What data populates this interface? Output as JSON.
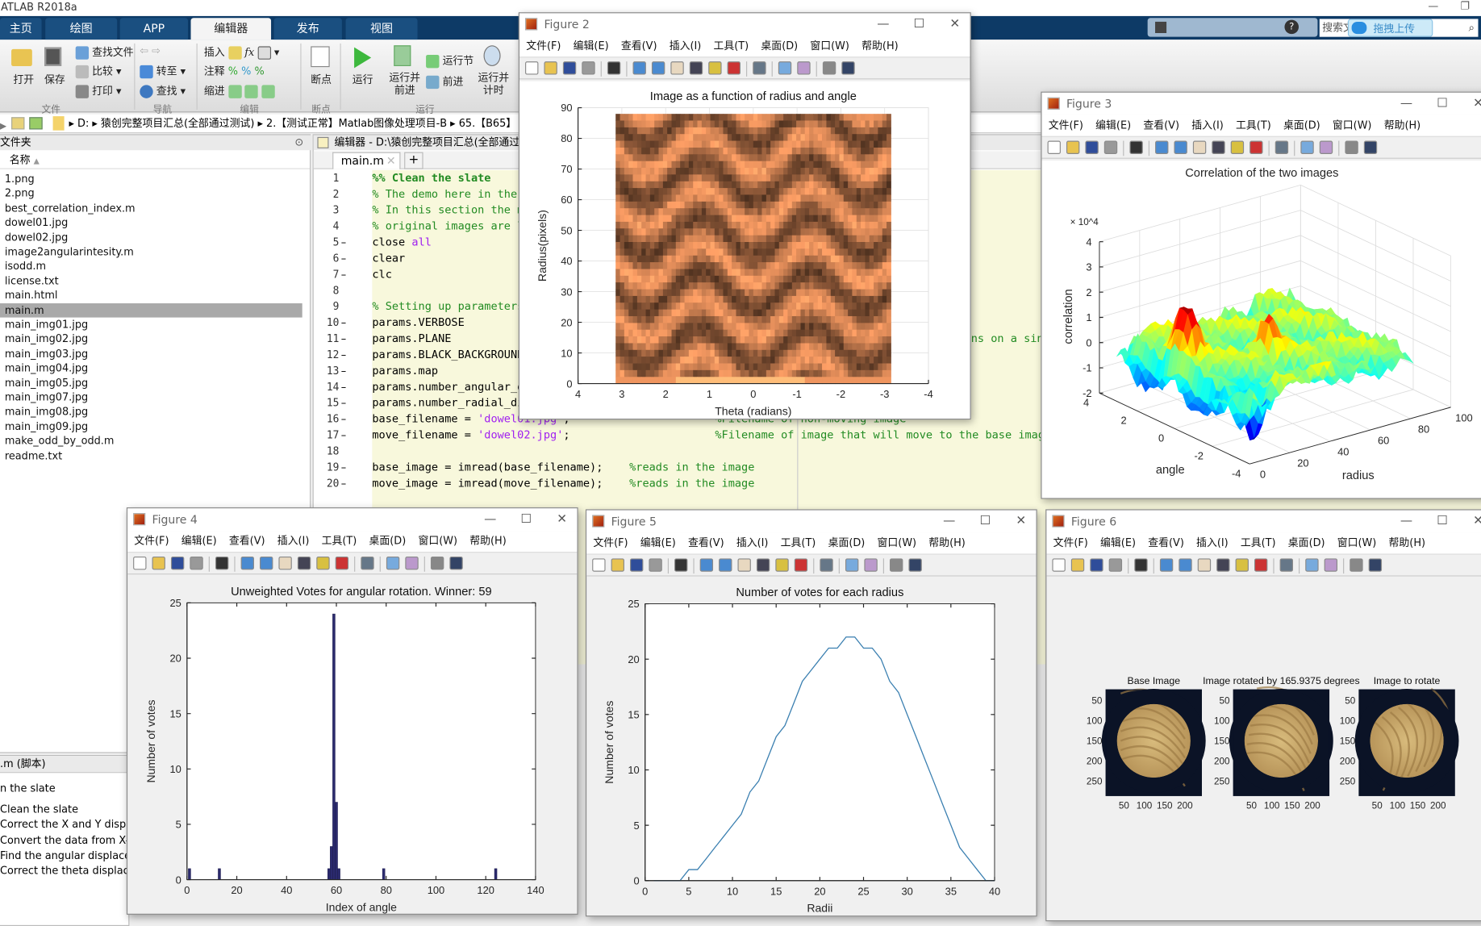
{
  "app": {
    "title": "ATLAB R2018a"
  },
  "ribbon": {
    "tabs": [
      "主页",
      "绘图",
      "APP",
      "编辑器",
      "发布",
      "视图"
    ],
    "active_tab": "编辑器",
    "file_group": {
      "label": "文件",
      "open": "打开",
      "save": "保存",
      "find_files": "查找文件",
      "compare": "比较",
      "print": "打印"
    },
    "nav_group": {
      "label": "导航",
      "goto": "转至",
      "find": "查找"
    },
    "edit_group": {
      "label": "编辑",
      "insert": "插入",
      "comment": "注释",
      "indent": "缩进"
    },
    "breakpoint_group": {
      "label": "断点",
      "breakpoints": "断点"
    },
    "run_group": {
      "label": "运行",
      "run": "运行",
      "run_advance": "运行并\n前进",
      "run_section": "运行节",
      "advance": "前进",
      "run_time": "运行并\n计时"
    },
    "search_placeholder": "搜索文",
    "upload_overlay": "拖拽上传"
  },
  "address": {
    "segments": [
      "D:",
      "猿创完整项目汇总(全部通过测试)",
      "2.【测试正常】Matlab图像处理项目-B",
      "65.【B65】"
    ]
  },
  "files": {
    "header": "文件夹",
    "column": "名称",
    "selected": "main.m",
    "items": [
      "1.png",
      "2.png",
      "best_correlation_index.m",
      "dowel01.jpg",
      "dowel02.jpg",
      "image2angularintesity.m",
      "isodd.m",
      "license.txt",
      "main.html",
      "main.m",
      "main_img01.jpg",
      "main_img02.jpg",
      "main_img03.jpg",
      "main_img04.jpg",
      "main_img05.jpg",
      "main_img07.jpg",
      "main_img08.jpg",
      "main_img09.jpg",
      "make_odd_by_odd.m",
      "readme.txt"
    ]
  },
  "details": {
    "header": ".m  (脚本)",
    "title": "n the slate",
    "items": [
      "Clean the slate",
      "Correct the X and Y displac",
      "Convert the data from X-Y c",
      "Find the angular displaceme",
      "Correct the theta displacem"
    ]
  },
  "editor": {
    "title": "编辑器 - D:\\猿创完整项目汇总(全部通过测试",
    "tab": "main.m",
    "fragment": "ns on a singl",
    "lines": [
      {
        "n": "1",
        "dash": "",
        "parts": [
          [
            "%% Clean the slate",
            "sec"
          ]
        ]
      },
      {
        "n": "2",
        "dash": "",
        "parts": [
          [
            "% The demo here in the mai",
            "cm"
          ]
        ]
      },
      {
        "n": "3",
        "dash": "",
        "parts": [
          [
            "% In this section the memo",
            "cm"
          ]
        ]
      },
      {
        "n": "4",
        "dash": "",
        "parts": [
          [
            "% original images are load",
            "cm"
          ]
        ]
      },
      {
        "n": "5",
        "dash": "–",
        "parts": [
          [
            "close ",
            "tx"
          ],
          [
            "all",
            "str"
          ]
        ]
      },
      {
        "n": "6",
        "dash": "–",
        "parts": [
          [
            "clear",
            "tx"
          ]
        ]
      },
      {
        "n": "7",
        "dash": "–",
        "parts": [
          [
            "clc",
            "tx"
          ]
        ]
      },
      {
        "n": "8",
        "dash": "",
        "parts": []
      },
      {
        "n": "9",
        "dash": "",
        "parts": [
          [
            "% Setting up parameters an",
            "cm"
          ]
        ]
      },
      {
        "n": "10",
        "dash": "–",
        "parts": [
          [
            "params.VERBOSE          =",
            "tx"
          ]
        ]
      },
      {
        "n": "11",
        "dash": "–",
        "parts": [
          [
            "params.PLANE            =",
            "tx"
          ]
        ]
      },
      {
        "n": "12",
        "dash": "–",
        "parts": [
          [
            "params.BLACK_BACKGROUND =",
            "tx"
          ]
        ]
      },
      {
        "n": "13",
        "dash": "–",
        "parts": [
          [
            "params.map",
            "tx"
          ]
        ]
      },
      {
        "n": "14",
        "dash": "–",
        "parts": [
          [
            "params.number_angular_divi",
            "tx"
          ]
        ]
      },
      {
        "n": "15",
        "dash": "–",
        "parts": [
          [
            "params.number_radial_divis",
            "tx"
          ]
        ]
      },
      {
        "n": "16",
        "dash": "–",
        "parts": [
          [
            "base_filename = ",
            "tx"
          ],
          [
            "'dowel01.jpg'",
            "str"
          ],
          [
            ";                      ",
            "tx"
          ],
          [
            "%Filename of non-moving image",
            "cm"
          ]
        ]
      },
      {
        "n": "17",
        "dash": "–",
        "parts": [
          [
            "move_filename = ",
            "tx"
          ],
          [
            "'dowel02.jpg'",
            "str"
          ],
          [
            ";                      ",
            "tx"
          ],
          [
            "%Filename of image that will move to the base image",
            "cm"
          ]
        ]
      },
      {
        "n": "18",
        "dash": "",
        "parts": []
      },
      {
        "n": "19",
        "dash": "–",
        "parts": [
          [
            "base_image = imread(base_filename);    ",
            "tx"
          ],
          [
            "%reads in the image",
            "cm"
          ]
        ]
      },
      {
        "n": "20",
        "dash": "–",
        "parts": [
          [
            "move_image = imread(move_filename);    ",
            "tx"
          ],
          [
            "%reads in the image",
            "cm"
          ]
        ]
      }
    ]
  },
  "figure_menu": [
    "文件(F)",
    "编辑(E)",
    "查看(V)",
    "插入(I)",
    "工具(T)",
    "桌面(D)",
    "窗口(W)",
    "帮助(H)"
  ],
  "figure_toolbar_icons": [
    "new-icon",
    "open-icon",
    "save-icon",
    "print-icon",
    "|",
    "pointer-icon",
    "|",
    "zoom-in-icon",
    "zoom-out-icon",
    "pan-icon",
    "rotate-icon",
    "data-cursor-icon",
    "brush-icon",
    "|",
    "link-icon",
    "|",
    "colorbar-icon",
    "legend-icon",
    "|",
    "hide-tools-icon",
    "show-tools-icon"
  ],
  "figures": [
    {
      "title": "Figure 2"
    },
    {
      "title": "Figure 3"
    },
    {
      "title": "Figure 4"
    },
    {
      "title": "Figure 5"
    },
    {
      "title": "Figure 6",
      "images": [
        {
          "title": "Base Image",
          "yticks": [
            "50",
            "100",
            "150",
            "200",
            "250"
          ],
          "xticks": [
            "50",
            "100",
            "150",
            "200"
          ]
        },
        {
          "title": "Image rotated by 165.9375 degrees",
          "yticks": [
            "50",
            "100",
            "150",
            "200",
            "250"
          ],
          "xticks": [
            "50",
            "100",
            "150",
            "200"
          ]
        },
        {
          "title": "Image to rotate",
          "yticks": [
            "50",
            "100",
            "150",
            "200",
            "250"
          ],
          "xticks": [
            "50",
            "100",
            "150",
            "200"
          ]
        }
      ]
    }
  ],
  "chart_data": [
    {
      "type": "heatmap",
      "title": "Image as a function of radius and angle",
      "xlabel": "Theta (radians)",
      "ylabel": "Radius(pixels)",
      "xlim": [
        4,
        -4
      ],
      "ylim": [
        0,
        90
      ],
      "xdir": "reverse",
      "colormap": "copper",
      "grid": true,
      "xticks": [
        "4",
        "3",
        "2",
        "1",
        "0",
        "-1",
        "-2",
        "-3",
        "-4"
      ],
      "yticks": [
        "0",
        "10",
        "20",
        "30",
        "40",
        "50",
        "60",
        "70",
        "80",
        "90"
      ]
    },
    {
      "type": "surface",
      "title": "Correlation of the two images",
      "xlabel": "radius",
      "ylabel": "angle",
      "zlabel": "correlation",
      "zexponent": "× 10^4",
      "xlim": [
        0,
        100
      ],
      "ylim": [
        -4,
        4
      ],
      "zlim": [
        -2,
        4
      ],
      "colormap": "jet",
      "grid": true,
      "xticks": [
        "0",
        "20",
        "40",
        "60",
        "80",
        "100"
      ],
      "yticks": [
        "4",
        "2",
        "0",
        "-2",
        "-4"
      ],
      "zticks": [
        "4",
        "3",
        "2",
        "1",
        "0",
        "-1",
        "-2"
      ]
    },
    {
      "type": "bar",
      "title": "Unweighted Votes for angular rotation. Winner: 59",
      "xlabel": "Index of angle",
      "ylabel": "Number of votes",
      "xlim": [
        0,
        140
      ],
      "ylim": [
        0,
        25
      ],
      "color": "#2b2a6e",
      "x": [
        1,
        13,
        57,
        58,
        59,
        60,
        61,
        79,
        124
      ],
      "values": [
        1,
        1,
        1,
        3,
        24,
        7,
        1,
        1,
        1
      ],
      "xticks": [
        "0",
        "20",
        "40",
        "60",
        "80",
        "100",
        "120",
        "140"
      ],
      "yticks": [
        "0",
        "5",
        "10",
        "15",
        "20",
        "25"
      ]
    },
    {
      "type": "line",
      "title": "Number of votes for each radius",
      "xlabel": "Radii",
      "ylabel": "Number of votes",
      "xlim": [
        0,
        40
      ],
      "ylim": [
        0,
        25
      ],
      "color": "#3a7fb0",
      "x": [
        1,
        2,
        3,
        4,
        5,
        6,
        7,
        8,
        9,
        10,
        11,
        12,
        13,
        14,
        15,
        16,
        17,
        18,
        19,
        20,
        21,
        22,
        23,
        24,
        25,
        26,
        27,
        28,
        29,
        30,
        31,
        32,
        33,
        34,
        35,
        36,
        37,
        38,
        39,
        40
      ],
      "values": [
        0,
        0,
        0,
        0,
        1,
        1,
        2,
        3,
        4,
        5,
        6,
        8,
        9,
        11,
        13,
        14,
        16,
        18,
        19,
        20,
        21,
        21,
        22,
        22,
        21,
        21,
        20,
        18,
        17,
        15,
        13,
        11,
        9,
        7,
        5,
        3,
        2,
        1,
        0,
        0
      ],
      "xticks": [
        "0",
        "5",
        "10",
        "15",
        "20",
        "25",
        "30",
        "35",
        "40"
      ],
      "yticks": [
        "0",
        "5",
        "10",
        "15",
        "20",
        "25"
      ]
    }
  ]
}
